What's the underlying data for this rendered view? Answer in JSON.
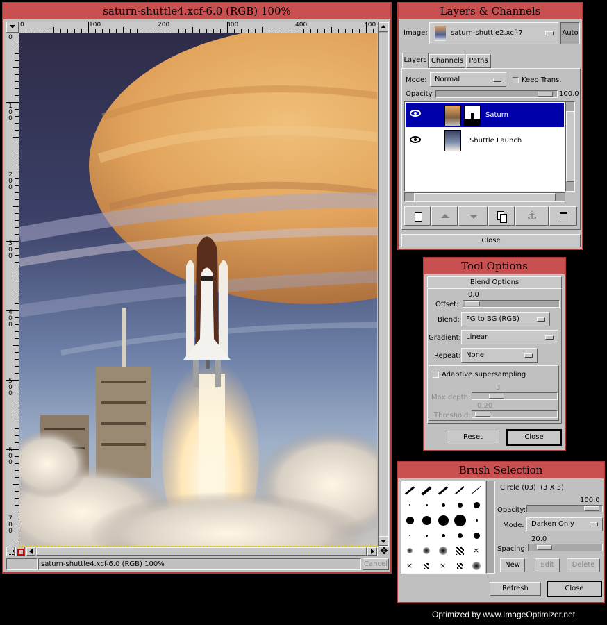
{
  "image_window": {
    "title": "saturn-shuttle4.xcf-6.0 (RGB) 100%",
    "status": "saturn-shuttle4.xcf-6.0 (RGB) 100%",
    "cancel_label": "Cancel",
    "ruler_h": [
      "0",
      "100",
      "200",
      "300",
      "400",
      "500"
    ],
    "ruler_v": [
      "0",
      "100",
      "200",
      "300",
      "400",
      "500",
      "600",
      "700"
    ]
  },
  "layers_window": {
    "title": "Layers & Channels",
    "image_label": "Image:",
    "image_value": "saturn-shuttle2.xcf-7",
    "auto_label": "Auto",
    "tabs": [
      "Layers",
      "Channels",
      "Paths"
    ],
    "mode_label": "Mode:",
    "mode_value": "Normal",
    "keep_trans_label": "Keep Trans.",
    "opacity_label": "Opacity:",
    "opacity_value": "100.0",
    "layers": [
      {
        "name": "Saturn",
        "selected": true
      },
      {
        "name": "Shuttle Launch",
        "selected": false
      }
    ],
    "close_label": "Close"
  },
  "tool_options": {
    "title": "Tool Options",
    "section": "Blend Options",
    "offset_label": "Offset:",
    "offset_value": "0.0",
    "blend_label": "Blend:",
    "blend_value": "FG to BG (RGB)",
    "gradient_label": "Gradient:",
    "gradient_value": "Linear",
    "repeat_label": "Repeat:",
    "repeat_value": "None",
    "adaptive_label": "Adaptive supersampling",
    "max_depth_label": "Max depth:",
    "max_depth_value": "3",
    "threshold_label": "Threshold:",
    "threshold_value": "0.20",
    "reset_label": "Reset",
    "close_label": "Close"
  },
  "brush_window": {
    "title": "Brush Selection",
    "brush_name": "Circle (03)  (3 X 3)",
    "opacity_label": "Opacity:",
    "opacity_value": "100.0",
    "mode_label": "Mode:",
    "mode_value": "Darken Only",
    "spacing_label": "Spacing:",
    "spacing_value": "20.0",
    "new_label": "New",
    "edit_label": "Edit",
    "delete_label": "Delete",
    "refresh_label": "Refresh",
    "close_label": "Close"
  },
  "footer": {
    "credit": "Optimized by www.ImageOptimizer.net"
  },
  "colors": {
    "title_bar": "#c85050",
    "window_bg": "#c0c0c0",
    "selection": "#0000aa"
  }
}
